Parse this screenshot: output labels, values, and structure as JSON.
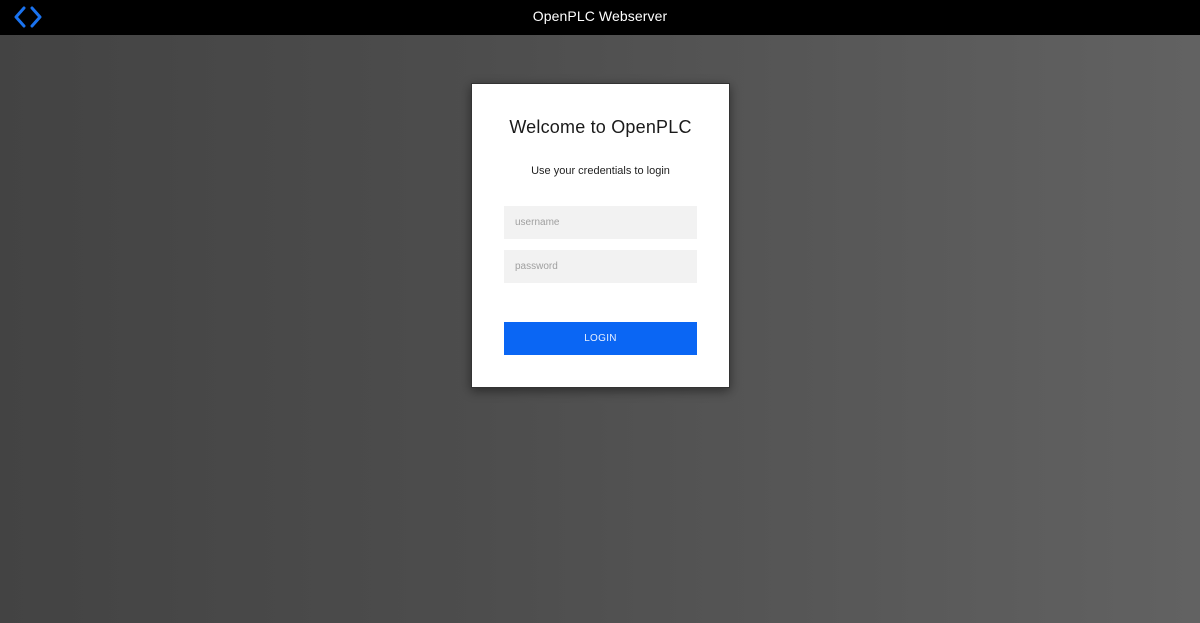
{
  "header": {
    "title": "OpenPLC Webserver",
    "logo_icon": "code-brackets-icon",
    "accent_color": "#1a73f0"
  },
  "login": {
    "title": "Welcome to OpenPLC",
    "subtitle": "Use your credentials to login",
    "username": {
      "value": "",
      "placeholder": "username"
    },
    "password": {
      "value": "",
      "placeholder": "password"
    },
    "button_label": "LOGIN",
    "button_color": "#0a66f4"
  }
}
